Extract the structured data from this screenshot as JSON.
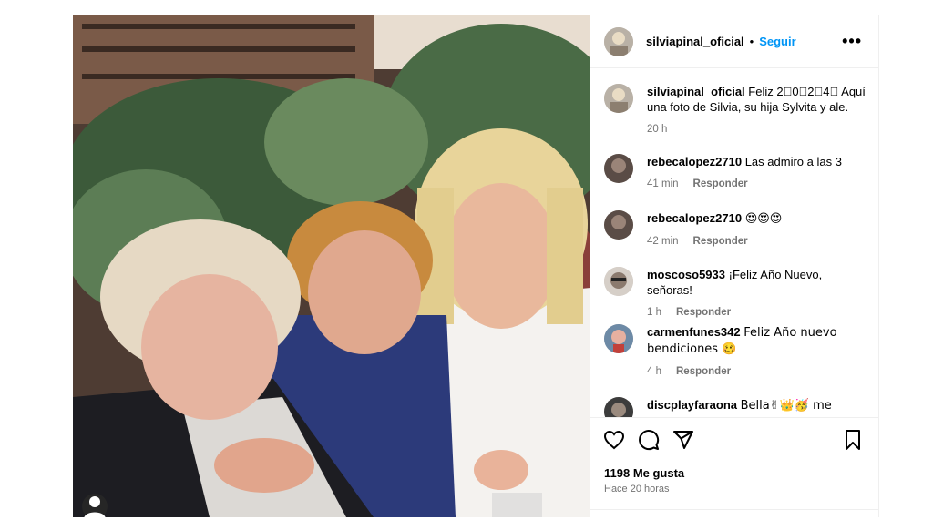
{
  "post": {
    "author": "silviapinal_oficial",
    "follow_label": "Seguir",
    "separator": "•",
    "more_label": "•••"
  },
  "caption": {
    "username": "silviapinal_oficial",
    "text": "Feliz 2⃣0⃣2⃣4⃣ Aquí una foto de Silvia, su hija Sylvita y ale.",
    "time": "20 h"
  },
  "comments": [
    {
      "username": "rebecalopez2710",
      "text": "Las admiro a las 3",
      "time": "41 min",
      "reply": "Responder"
    },
    {
      "username": "rebecalopez2710",
      "text": "😍😍😍",
      "time": "42 min",
      "reply": "Responder"
    },
    {
      "username": "moscoso5933",
      "text": "¡Feliz Año Nuevo, señoras!",
      "time": "1 h",
      "reply": "Responder"
    },
    {
      "username": "carmenfunes342",
      "text": "Feliz Año nuevo bendiciones 🥴",
      "time": "4 h",
      "reply": "Responder"
    },
    {
      "username": "discplayfaraona",
      "text": "Bella✌👑🥳 me",
      "time": "",
      "reply": ""
    }
  ],
  "likes": "1198 Me gusta",
  "posted": "Hace 20 horas",
  "icons": [
    "heart-icon",
    "comment-icon",
    "share-icon",
    "save-icon",
    "more-icon",
    "user-tag-icon"
  ],
  "colors": {
    "link": "#0095f6",
    "secondary": "#737373",
    "border": "#efefef"
  }
}
